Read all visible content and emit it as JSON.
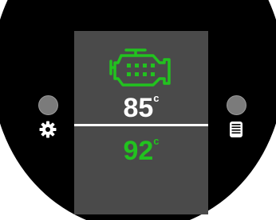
{
  "display": {
    "top_temp": "85",
    "top_unit": "c",
    "bottom_temp": "92",
    "bottom_unit": "c"
  },
  "colors": {
    "bezel": "#000000",
    "screen": "#4a4a4a",
    "accent_green": "#22c21f",
    "text_white": "#ffffff",
    "button_grey": "#7b7b7b"
  },
  "icons": {
    "status": "engine-icon",
    "left": "gear-icon",
    "right": "list-icon"
  }
}
